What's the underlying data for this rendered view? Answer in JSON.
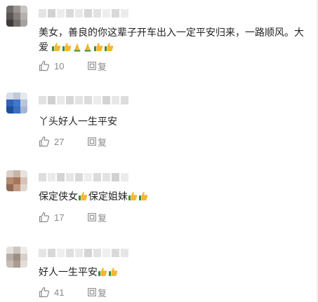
{
  "comments": [
    {
      "text": "美女，善良的你这辈子开车出入一定平安归来，一路顺风。大爱",
      "emojis": [
        "thumbs-up-icon",
        "thumbs-up-icon",
        "praying-hands-icon",
        "praying-hands-icon",
        "thumbs-up-icon",
        "thumbs-up-icon"
      ],
      "likes": "10",
      "reply_label": "复"
    },
    {
      "text": "丫头好人一生平安",
      "emojis": [],
      "likes": "27",
      "reply_label": "复"
    },
    {
      "text_a": "保定侠女",
      "text_b": "保定姐妹",
      "emojis_a": [
        "thumbs-up-icon"
      ],
      "emojis_b": [
        "thumbs-up-icon",
        "thumbs-up-icon"
      ],
      "likes": "17",
      "reply_label": "复"
    },
    {
      "text": "好人一生平安",
      "emojis": [
        "thumbs-up-icon",
        "thumbs-up-icon"
      ],
      "likes": "41",
      "reply_label": "复"
    }
  ],
  "colors": {
    "text": "#222222",
    "meta": "#8a8a8a",
    "emoji_yellow": "#f5b82e",
    "emoji_green": "#4caf50"
  }
}
